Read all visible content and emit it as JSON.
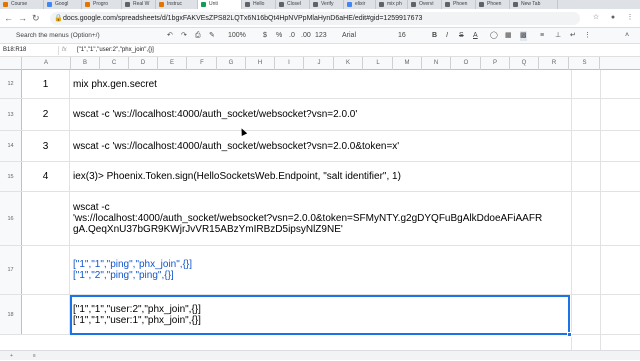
{
  "browser": {
    "tabs": [
      {
        "label": "Course",
        "color": "#e37400"
      },
      {
        "label": "Googl",
        "color": "#4285f4"
      },
      {
        "label": "Progro",
        "color": "#e37400"
      },
      {
        "label": "Real W",
        "color": "#5f6368"
      },
      {
        "label": "Instruc",
        "color": "#e37400"
      },
      {
        "label": "Unti",
        "color": "#0f9d58"
      },
      {
        "label": "Hello",
        "color": "#5f6368"
      },
      {
        "label": "Closel",
        "color": "#5f6368"
      },
      {
        "label": "Verify",
        "color": "#5f6368"
      },
      {
        "label": "elixir",
        "color": "#4285f4"
      },
      {
        "label": "mix ph",
        "color": "#5f6368"
      },
      {
        "label": "Overvi",
        "color": "#5f6368"
      },
      {
        "label": "Phoen",
        "color": "#5f6368"
      },
      {
        "label": "Phoen",
        "color": "#5f6368"
      },
      {
        "label": "New Tab",
        "color": "#5f6368"
      }
    ],
    "url": "docs.google.com/spreadsheets/d/1bgxFAKVEsZPS82LQTx6N16bQt4HpNVPpMlaHynD6aHE/edit#gid=1259917673"
  },
  "toolbar": {
    "search_menus": "Search the menus (Option+/)",
    "zoom": "100%",
    "currency": "$",
    "percent": "%",
    "dec_decrease": ".0",
    "dec_increase": ".00",
    "format_123": "123",
    "font": "Arial",
    "font_size": "16",
    "bold": "B",
    "italic": "I",
    "strike": "S",
    "text_color": "A"
  },
  "formula": {
    "namebox": "B18:R18",
    "fx_label": "fx",
    "content": "[\"1\",\"1\",\"user:2\",\"phx_join\",{}]"
  },
  "columns": [
    "A",
    "B",
    "C",
    "D",
    "E",
    "F",
    "G",
    "H",
    "I",
    "J",
    "K",
    "L",
    "M",
    "N",
    "O",
    "P",
    "Q",
    "R",
    "S"
  ],
  "rows": [
    {
      "num": "12",
      "a": "1",
      "b": "mix phx.gen.secret",
      "blue": false
    },
    {
      "num": "13",
      "a": "2",
      "b": "wscat -c 'ws://localhost:4000/auth_socket/websocket?vsn=2.0.0'",
      "blue": false
    },
    {
      "num": "14",
      "a": "3",
      "b": "wscat -c 'ws://localhost:4000/auth_socket/websocket?vsn=2.0.0&token=x'",
      "blue": false
    },
    {
      "num": "15",
      "a": "4",
      "b": "iex(3)> Phoenix.Token.sign(HelloSocketsWeb.Endpoint, \"salt identifier\", 1)",
      "blue": false
    },
    {
      "num": "16",
      "a": "",
      "b": "wscat -c\n'ws://localhost:4000/auth_socket/websocket?vsn=2.0.0&token=SFMyNTY.g2gDYQFuBgAlkDdoeAFiAAFR\ngA.QeqXnU37bGR9KWjrJvVR15ABzYmIRBzD5ipsyNlZ9NE'",
      "blue": false
    },
    {
      "num": "17",
      "a": "",
      "b": "[\"1\",\"1\",\"ping\",\"phx_join\",{}]\n[\"1\",\"2\",\"ping\",\"ping\",{}]",
      "blue": true
    },
    {
      "num": "18",
      "a": "",
      "b": "[\"1\",\"1\",\"user:2\",\"phx_join\",{}]\n[\"1\",\"1\",\"user:1\",\"phx_join\",{}]",
      "blue": false
    }
  ]
}
